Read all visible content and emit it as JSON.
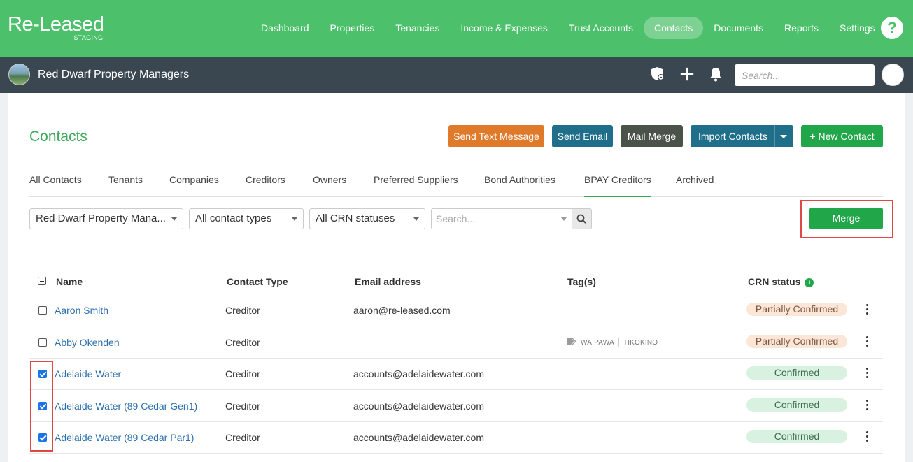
{
  "brand": {
    "name": "Re-Leased",
    "env": "STAGING"
  },
  "nav": {
    "items": [
      {
        "label": "Dashboard"
      },
      {
        "label": "Properties"
      },
      {
        "label": "Tenancies"
      },
      {
        "label": "Income & Expenses"
      },
      {
        "label": "Trust Accounts"
      },
      {
        "label": "Contacts",
        "active": true
      },
      {
        "label": "Documents"
      },
      {
        "label": "Reports"
      },
      {
        "label": "Settings"
      }
    ],
    "help": "?"
  },
  "orgbar": {
    "org_name": "Red Dwarf Property Managers",
    "search_placeholder": "Search..."
  },
  "page": {
    "title": "Contacts",
    "actions": {
      "send_text": "Send Text Message",
      "send_email": "Send Email",
      "mail_merge": "Mail Merge",
      "import_contacts": "Import Contacts",
      "new_contact": "New Contact"
    },
    "tabs": [
      "All Contacts",
      "Tenants",
      "Companies",
      "Creditors",
      "Owners",
      "Preferred Suppliers",
      "Bond Authorities",
      "BPAY Creditors",
      "Archived"
    ],
    "active_tab": "BPAY Creditors",
    "filters": {
      "org": "Red Dwarf Property Mana...",
      "contact_type": "All contact types",
      "crn_status": "All CRN statuses",
      "search_placeholder": "Search..."
    },
    "merge_label": "Merge"
  },
  "table": {
    "columns": {
      "name": "Name",
      "contact_type": "Contact Type",
      "email": "Email address",
      "tags": "Tag(s)",
      "crn": "CRN status"
    },
    "rows": [
      {
        "name": "Aaron Smith",
        "type": "Creditor",
        "email": "aaron@re-leased.com",
        "tags": [],
        "crn": "Partially Confirmed",
        "checked": false
      },
      {
        "name": "Abby Okenden",
        "type": "Creditor",
        "email": "",
        "tags": [
          "WAIPAWA",
          "TIKOKINO"
        ],
        "crn": "Partially Confirmed",
        "checked": false
      },
      {
        "name": "Adelaide Water",
        "type": "Creditor",
        "email": "accounts@adelaidewater.com",
        "tags": [],
        "crn": "Confirmed",
        "checked": true
      },
      {
        "name": "Adelaide Water (89 Cedar Gen1)",
        "type": "Creditor",
        "email": "accounts@adelaidewater.com",
        "tags": [],
        "crn": "Confirmed",
        "checked": true
      },
      {
        "name": "Adelaide Water (89 Cedar Par1)",
        "type": "Creditor",
        "email": "accounts@adelaidewater.com",
        "tags": [],
        "crn": "Confirmed",
        "checked": true
      }
    ]
  },
  "colors": {
    "brand_green": "#4cc06a",
    "dark_bar": "#3a4650",
    "highlight_red": "#e04848"
  }
}
